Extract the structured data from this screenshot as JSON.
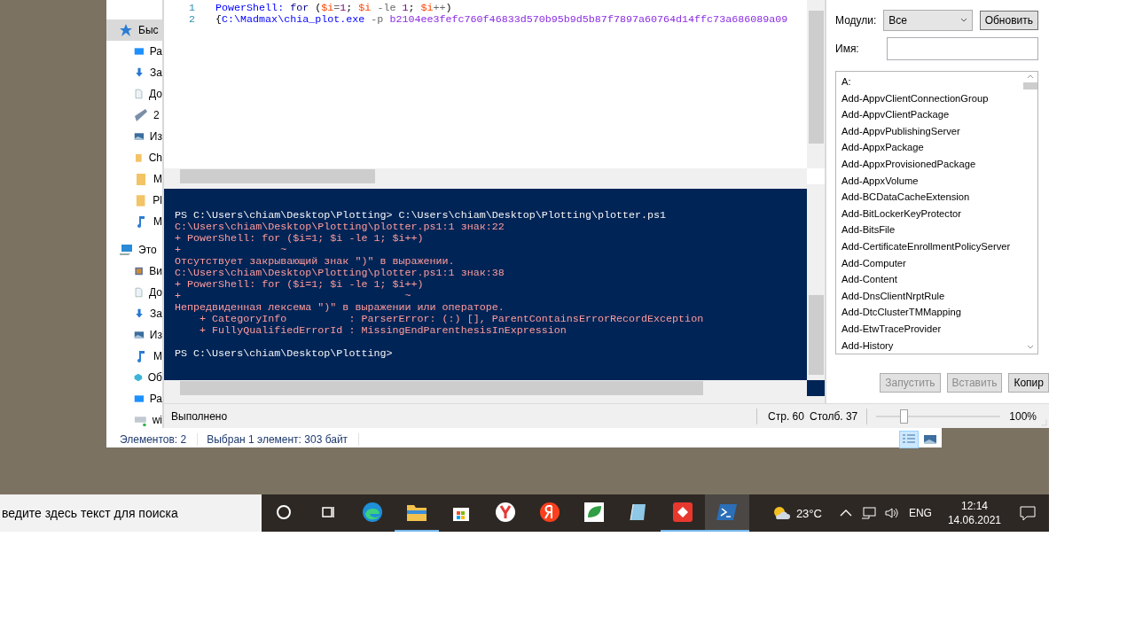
{
  "explorer": {
    "nav": [
      {
        "label": "Быс",
        "selected": true,
        "children": [
          {
            "label": "Ра"
          },
          {
            "label": "За"
          },
          {
            "label": "До"
          },
          {
            "label": "2"
          },
          {
            "label": "Из"
          },
          {
            "label": "Ch"
          },
          {
            "label": "M"
          },
          {
            "label": "Pl"
          },
          {
            "label": "M"
          }
        ]
      },
      {
        "label": "Это",
        "selected": false,
        "children": [
          {
            "label": "Ви"
          },
          {
            "label": "До"
          },
          {
            "label": "За"
          },
          {
            "label": "Из"
          },
          {
            "label": "M"
          },
          {
            "label": "Об"
          },
          {
            "label": "Ра"
          },
          {
            "label": "wi"
          }
        ]
      }
    ],
    "status": {
      "count": "Элементов: 2",
      "selection": "Выбран 1 элемент: 303 байт"
    },
    "views": [
      {
        "selected": true
      },
      {
        "selected": false
      }
    ]
  },
  "ise": {
    "editor": {
      "lines": [
        {
          "number": "1",
          "tokens": [
            {
              "kind": "command",
              "text": "PowerShell:"
            },
            {
              "kind": "keyword",
              "text": " for "
            },
            {
              "kind": "plain",
              "text": "("
            },
            {
              "kind": "variable",
              "text": "$i"
            },
            {
              "kind": "operator",
              "text": "="
            },
            {
              "kind": "number",
              "text": "1"
            },
            {
              "kind": "plain",
              "text": "; "
            },
            {
              "kind": "variable",
              "text": "$i"
            },
            {
              "kind": "operator",
              "text": " -le "
            },
            {
              "kind": "number",
              "text": "1"
            },
            {
              "kind": "plain",
              "text": "; "
            },
            {
              "kind": "variable",
              "text": "$i"
            },
            {
              "kind": "operator",
              "text": "++"
            },
            {
              "kind": "plain",
              "text": ")"
            }
          ]
        },
        {
          "number": "2",
          "tokens": [
            {
              "kind": "plain",
              "text": "{"
            },
            {
              "kind": "command",
              "text": "C:\\Madmax\\chia_plot.exe"
            },
            {
              "kind": "operator",
              "text": " -p "
            },
            {
              "kind": "argument",
              "text": "b2104ee3fefc760f46833d570b95b9d5b87f7897a60764d14ffc73a686089a09"
            }
          ]
        }
      ]
    },
    "console": [
      {
        "kind": "prompt",
        "text": "PS C:\\Users\\chiam\\Desktop\\Plotting> C:\\Users\\chiam\\Desktop\\Plotting\\plotter.ps1"
      },
      {
        "kind": "error",
        "text": "C:\\Users\\chiam\\Desktop\\Plotting\\plotter.ps1:1 знак:22"
      },
      {
        "kind": "error",
        "text": "+ PowerShell: for ($i=1; $i -le 1; $i++)"
      },
      {
        "kind": "error",
        "text": "+                ~"
      },
      {
        "kind": "error",
        "text": "Отсутствует закрывающий знак \")\" в выражении."
      },
      {
        "kind": "error",
        "text": "C:\\Users\\chiam\\Desktop\\Plotting\\plotter.ps1:1 знак:38"
      },
      {
        "kind": "error",
        "text": "+ PowerShell: for ($i=1; $i -le 1; $i++)"
      },
      {
        "kind": "error",
        "text": "+                                    ~"
      },
      {
        "kind": "error",
        "text": "Непредвиденная лексема \")\" в выражении или операторе."
      },
      {
        "kind": "error",
        "text": "    + CategoryInfo          : ParserError: (:) [], ParentContainsErrorRecordException"
      },
      {
        "kind": "error",
        "text": "    + FullyQualifiedErrorId : MissingEndParenthesisInExpression"
      },
      {
        "kind": "prompt",
        "text": "PS C:\\Users\\chiam\\Desktop\\Plotting>"
      }
    ],
    "status": {
      "state": "Выполнено",
      "line": "Стр. 60",
      "column": "Столб. 37",
      "zoom": {
        "level": 0.22
      },
      "zoom_label": "100%"
    },
    "commands": {
      "modules_label": "Модули:",
      "modules_value": "Все",
      "refresh": "Обновить",
      "name_label": "Имя:",
      "items": [
        "A:",
        "Add-AppvClientConnectionGroup",
        "Add-AppvClientPackage",
        "Add-AppvPublishingServer",
        "Add-AppxPackage",
        "Add-AppxProvisionedPackage",
        "Add-AppxVolume",
        "Add-BCDataCacheExtension",
        "Add-BitLockerKeyProtector",
        "Add-BitsFile",
        "Add-CertificateEnrollmentPolicyServer",
        "Add-Computer",
        "Add-Content",
        "Add-DnsClientNrptRule",
        "Add-DtcClusterTMMapping",
        "Add-EtwTraceProvider",
        "Add-History"
      ],
      "buttons": [
        {
          "label": "Запустить",
          "disabled": true
        },
        {
          "label": "Вставить",
          "disabled": true
        },
        {
          "label": "Копир",
          "disabled": false
        }
      ]
    }
  },
  "taskbar": {
    "search_placeholder": "ведите здесь текст для поиска",
    "apps": [
      {
        "running": false,
        "active": false
      },
      {
        "running": false,
        "active": false
      },
      {
        "running": false,
        "active": false
      },
      {
        "running": true,
        "active": false
      },
      {
        "running": false,
        "active": false
      },
      {
        "running": false,
        "active": false
      },
      {
        "running": false,
        "active": false
      },
      {
        "running": false,
        "active": false
      },
      {
        "running": false,
        "active": false
      },
      {
        "running": true,
        "active": false
      },
      {
        "running": true,
        "active": true
      }
    ],
    "temperature": "23°C",
    "language": "ENG",
    "time": "12:14",
    "date": "14.06.2021"
  }
}
